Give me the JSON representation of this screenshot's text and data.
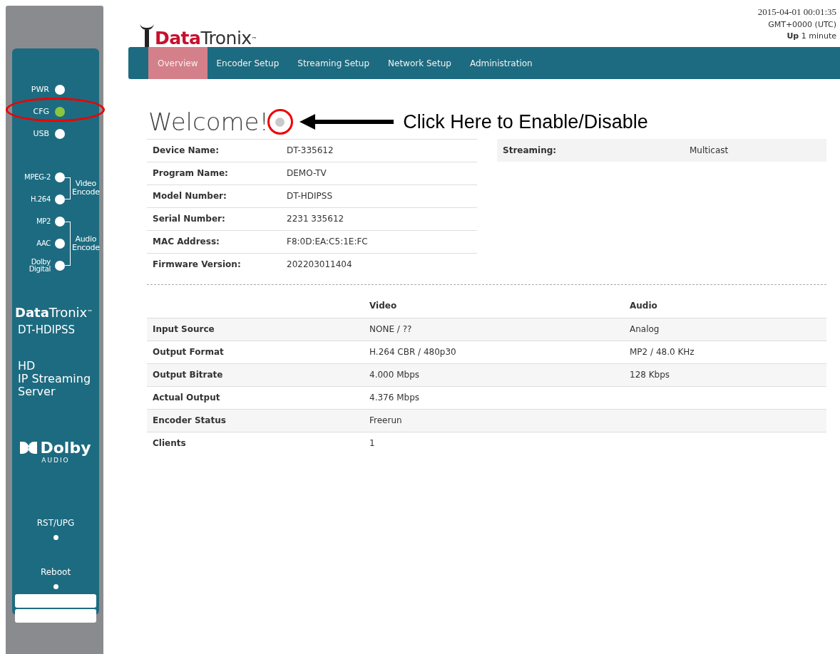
{
  "sidebar": {
    "leds": [
      {
        "label": "PWR",
        "color": "#ffffff"
      },
      {
        "label": "CFG",
        "color": "#8cc63f"
      },
      {
        "label": "USB",
        "color": "#ffffff"
      }
    ],
    "encode_groups": [
      {
        "label": "Video Encode",
        "leds": [
          {
            "label": "MPEG-2",
            "color": "#ffffff"
          },
          {
            "label": "H.264",
            "color": "#ffffff"
          }
        ]
      },
      {
        "label": "Audio Encode",
        "leds": [
          {
            "label": "MP2",
            "color": "#ffffff"
          },
          {
            "label": "AAC",
            "color": "#ffffff"
          },
          {
            "label": "Dolby Digital",
            "color": "#ffffff"
          }
        ]
      }
    ],
    "brand": "**Data**Tronix$^{™}$",
    "model": "DT-HDIPSS",
    "description": [
      "HD",
      "IP Streaming",
      "Server"
    ],
    "dolby": {
      "name": "Dolby",
      "sub": "AUDIO"
    },
    "buttons": [
      {
        "label": "RST/UPG"
      },
      {
        "label": "Reboot"
      }
    ]
  },
  "header": {
    "logo": "**Data**Tronix$^{™}$",
    "status": [
      "2015-04-01 00:01:35",
      "GMT+0000 (UTC)",
      "**Up** 1 minute"
    ]
  },
  "tabs": [
    {
      "label": "Overview",
      "selected": true
    },
    {
      "label": "Encoder Setup",
      "selected": false
    },
    {
      "label": "Streaming Setup",
      "selected": false
    },
    {
      "label": "Network Setup",
      "selected": false
    },
    {
      "label": "Administration",
      "selected": false
    }
  ],
  "welcome": {
    "title": "Welcome!",
    "on": false
  },
  "annotation": {
    "text": "Click Here to Enable/Disable"
  },
  "device_info": [
    {
      "label": "Device Name:",
      "value": "DT-335612"
    },
    {
      "label": "Program Name:",
      "value": "DEMO-TV"
    },
    {
      "label": "Model Number:",
      "value": "DT-HDIPSS"
    },
    {
      "label": "Serial Number:",
      "value": "2231 335612"
    },
    {
      "label": "MAC Address:",
      "value": "F8:0D:EA:C5:1E:FC"
    },
    {
      "label": "Firmware Version:",
      "value": "202203011404"
    }
  ],
  "streaming_info": [
    {
      "label": "Streaming:",
      "value": "Multicast"
    }
  ],
  "stats": {
    "columns": [
      "Video",
      "Audio"
    ],
    "rows": [
      {
        "label": "Input Source",
        "cells": [
          "NONE / ??",
          "Analog"
        ]
      },
      {
        "label": "Output Format",
        "cells": [
          "H.264 CBR / 480p30",
          "MP2 / 48.0 KHz"
        ]
      },
      {
        "label": "Output Bitrate",
        "cells": [
          "4.000 Mbps",
          "128 Kbps"
        ]
      },
      {
        "label": "Actual Output",
        "cells": [
          "4.376 Mbps"
        ]
      },
      {
        "label": "Encoder Status",
        "cells": [
          "Freerun"
        ]
      },
      {
        "label": "Clients",
        "cells": [
          "1"
        ]
      }
    ]
  }
}
